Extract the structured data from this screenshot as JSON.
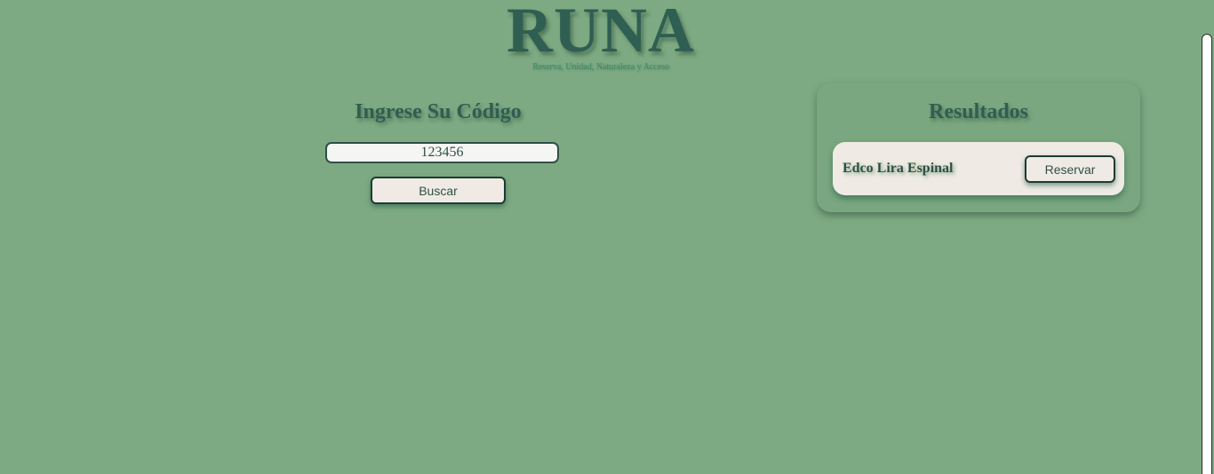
{
  "header": {
    "logo": "RUNA",
    "tagline": "Reserva, Unidad, Naturaleza y Acceso"
  },
  "search": {
    "title": "Ingrese Su Código",
    "code_value": "123456",
    "button_label": "Buscar"
  },
  "results": {
    "title": "Resultados",
    "items": [
      {
        "name": "Edco Lira Espinal",
        "button_label": "Reservar"
      }
    ]
  },
  "colors": {
    "background": "#7daa82",
    "accent_text": "#2f5e52",
    "card_background": "#efebe4"
  }
}
